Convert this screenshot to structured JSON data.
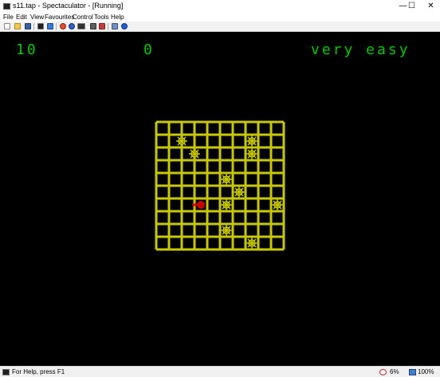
{
  "window": {
    "title": "s11.tap - Spectaculator - [Running]",
    "icon": "spectrum-app-icon",
    "controls": [
      "minimize-icon",
      "maximize-icon",
      "close-icon"
    ],
    "control_glyphs": [
      "—",
      "☐",
      "✕"
    ]
  },
  "menu": [
    "File",
    "Edit",
    "View",
    "Favourites",
    "Control",
    "Tools",
    "Help"
  ],
  "toolbar": {
    "icons": [
      "new-icon",
      "open-icon",
      "save-icon",
      "keyboard-icon",
      "display-icon",
      "record-icon",
      "pause-icon",
      "tape-icon",
      "snapshot-icon",
      "network-icon",
      "sound-icon",
      "help-icon"
    ]
  },
  "game": {
    "score_left": "10",
    "score_center": "0",
    "difficulty": "very easy",
    "colors": {
      "background": "#000000",
      "text": "#00c800",
      "grid": "#c8c800",
      "player": "#c80000"
    },
    "grid": {
      "columns": 11,
      "rows": 11
    },
    "spiders": [
      {
        "col": 2,
        "row": 1.5
      },
      {
        "col": 7.5,
        "row": 1.5
      },
      {
        "col": 3,
        "row": 2.5
      },
      {
        "col": 7.5,
        "row": 2.5
      },
      {
        "col": 5.5,
        "row": 4.5
      },
      {
        "col": 6.5,
        "row": 5.5
      },
      {
        "col": 5.5,
        "row": 6.5
      },
      {
        "col": 9.5,
        "row": 6.5
      },
      {
        "col": 5.5,
        "row": 8.5
      },
      {
        "col": 7.5,
        "row": 9.5
      }
    ],
    "player": {
      "col": 3.5,
      "row": 6.5
    }
  },
  "status": {
    "help_text": "For Help, press F1",
    "cpu": "6%",
    "speed": "100%"
  }
}
